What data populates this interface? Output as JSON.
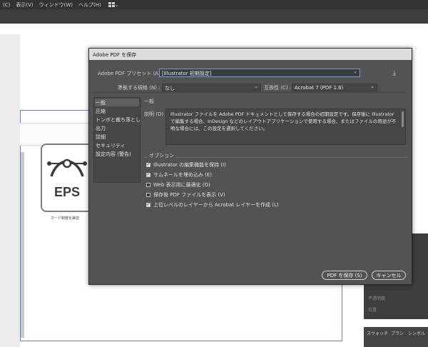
{
  "menubar": {
    "items": [
      "(C)",
      "表示(V)",
      "ウィンドウ(W)",
      "ヘルプ(H)"
    ],
    "workspace_icon": "grid-icon"
  },
  "canvas": {
    "eps_label": "EPS",
    "eps_caption": "カード制度化兼容"
  },
  "right_panel": {
    "row1": "不透明度",
    "row2": "位置",
    "tabs": [
      "スウォッチ",
      "ブラシ",
      "シンボル"
    ]
  },
  "dialog": {
    "title": "Adobe PDF を保存",
    "preset_label": "Adobe PDF プリセット (A) :",
    "preset_value": "[Illustrator 初期設定]",
    "standard_label": "準拠する規格 (N) :",
    "standard_value": "なし",
    "compat_label": "互換性 (C) :",
    "compat_value": "Acrobat 7 (PDF 1.6)",
    "sidebar": [
      "一般",
      "圧縮",
      "トンボと裁ち落とし",
      "出力",
      "詳細",
      "セキュリティ",
      "設定内容 (警告)"
    ],
    "section_title": "一般",
    "desc_label": "説明 (D) :",
    "description": "Illustrator ファイルを Adobe PDF ドキュメントとして保存する場合の初期設定です。保存後に Illustrator で編集する場合、InDesign などのレイアウトアプリケーションで使用する場合、またはファイルの用途が不明な場合には、この設定を選択してください。",
    "options_label": "オプション",
    "options": [
      {
        "label": "Illustrator の編集機能を保持 (I)",
        "checked": true
      },
      {
        "label": "サムネールを埋め込み (E)",
        "checked": true
      },
      {
        "label": "Web 表示用に最適化 (O)",
        "checked": false
      },
      {
        "label": "保存後 PDF ファイルを表示 (V)",
        "checked": false
      },
      {
        "label": "上位レベルのレイヤーから Acrobat レイヤーを作成 (L)",
        "checked": true
      }
    ],
    "save_label": "PDF を保存 (S)",
    "cancel_label": "キャンセル"
  }
}
